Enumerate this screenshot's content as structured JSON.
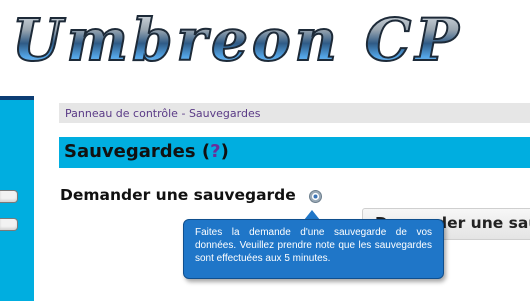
{
  "header": {
    "logo_text": "Umbreon CP"
  },
  "breadcrumb": {
    "items": [
      "Panneau de contrôle",
      "Sauvegardes"
    ],
    "separator": "-"
  },
  "page": {
    "title": "Sauvegardes",
    "help_open": "(",
    "help_label": "?",
    "help_close": ")"
  },
  "section": {
    "heading": "Demander une sauvegarde",
    "info_icon": "info-icon"
  },
  "request_button": {
    "label": "Demander une sauvegarde"
  },
  "tooltip": {
    "text": "Faites la demande d'une sauvegarde de vos données. Veuillez prendre note que les sauvegardes sont effectuées aux 5 minutes."
  },
  "colors": {
    "accent": "#00aee0",
    "sidebar_top": "#0c3d74",
    "tooltip_bg": "#1f76c8",
    "link": "#5a3a86",
    "help": "#6a2d9a",
    "breadcrumb_bg": "#e6e6e6"
  }
}
